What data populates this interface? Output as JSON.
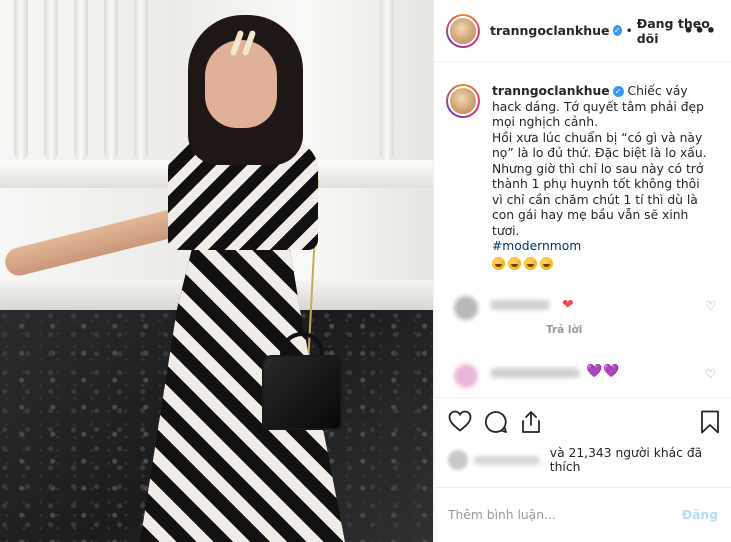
{
  "post": {
    "username": "tranngoclankhue",
    "follow_status": "Đang theo dõi",
    "more_glyph": "•••",
    "dot": "•",
    "verified_glyph": "✓"
  },
  "caption": {
    "lines": [
      "Chiếc váy hack dáng. Tớ quyết tâm phải đẹp mọi nghịch cảnh.",
      "Hồi xưa lúc chuẩn bị “có gì và này nọ” là lo đủ thứ. Đặc biệt là lo xấu. Nhưng giờ thì chỉ lo sau này có trở thành 1 phụ huynh tốt không thôi vì chỉ cần chăm chút 1 tí thì dù là con gái hay mẹ bầu vẫn sẽ xinh tươi."
    ],
    "hashtag": "#modernmom"
  },
  "comments": [
    {
      "reply_label": "Trả lời",
      "hearts": "❤",
      "like_glyph": "♡"
    },
    {
      "hearts": "💜💜",
      "like_glyph": "♡"
    }
  ],
  "actions": {
    "likes_text": "và 21,343 người khác đã thích",
    "icons": [
      "heart-icon",
      "comment-icon",
      "share-icon",
      "bookmark-icon"
    ]
  },
  "comment_box": {
    "placeholder": "Thêm bình luận...",
    "post_label": "Đăng"
  },
  "colors": {
    "verified_blue": "#3897f0",
    "post_disabled": "#b2dffc",
    "hashtag": "#003569",
    "like_red": "#ed4956"
  }
}
